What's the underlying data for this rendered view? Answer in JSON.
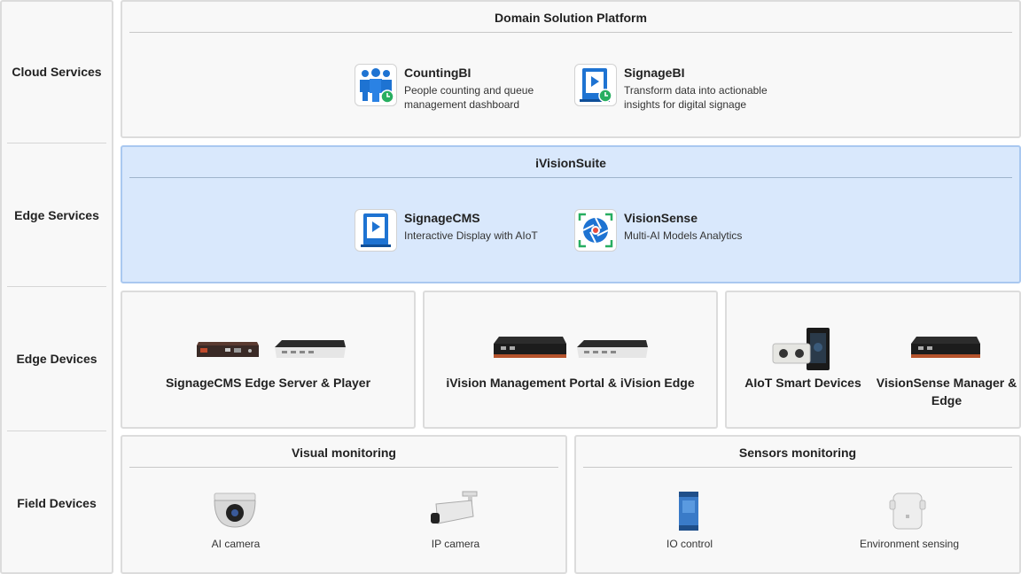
{
  "layers": {
    "cloud": "Cloud Services",
    "edge_services": "Edge Services",
    "edge_devices": "Edge Devices",
    "field": "Field Devices"
  },
  "cloud_panel": {
    "title": "Domain Solution Platform",
    "apps": [
      {
        "name": "CountingBI",
        "desc": "People counting and queue management dashboard",
        "icon": "people-counting-icon"
      },
      {
        "name": "SignageBI",
        "desc": "Transform data into actionable insights for digital signage",
        "icon": "signage-analytics-icon"
      }
    ]
  },
  "edge_services_panel": {
    "title": "iVisionSuite",
    "apps": [
      {
        "name": "SignageCMS",
        "desc": "Interactive Display with AIoT",
        "icon": "signage-play-icon"
      },
      {
        "name": "VisionSense",
        "desc": "Multi-AI Models Analytics",
        "icon": "camera-aperture-icon"
      }
    ]
  },
  "edge_devices": [
    {
      "label": "SignageCMS Edge Server & Player"
    },
    {
      "label": "iVision Management Portal & iVision Edge"
    },
    {
      "label": "AIoT Smart Devices"
    },
    {
      "label": "VisionSense Manager & Edge"
    }
  ],
  "field_devices": {
    "visual": {
      "title": "Visual monitoring",
      "items": [
        {
          "label": "AI camera"
        },
        {
          "label": "IP camera"
        }
      ]
    },
    "sensors": {
      "title": "Sensors monitoring",
      "items": [
        {
          "label": "IO control"
        },
        {
          "label": "Environment sensing"
        }
      ]
    }
  },
  "colors": {
    "panel_bg": "#f8f8f8",
    "panel_border": "#dcdcdc",
    "highlight_bg": "#d9e8fc",
    "highlight_border": "#a9c8f0",
    "icon_blue": "#1e73d2",
    "icon_green": "#27ae60"
  }
}
